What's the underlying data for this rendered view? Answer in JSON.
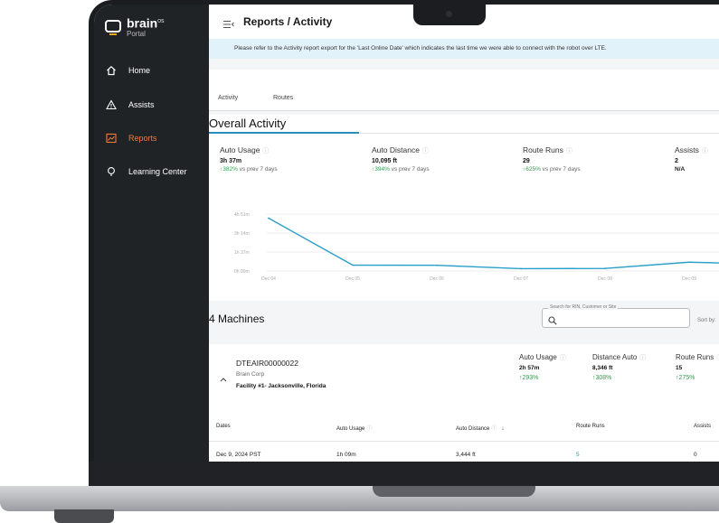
{
  "app": {
    "logo_text": "brain",
    "logo_sup": "OS",
    "logo_sub": "Portal"
  },
  "sidebar": {
    "items": [
      {
        "label": "Home",
        "icon": "home-icon"
      },
      {
        "label": "Assists",
        "icon": "warning-icon"
      },
      {
        "label": "Reports",
        "icon": "chart-icon",
        "active": true
      },
      {
        "label": "Learning Center",
        "icon": "lightbulb-icon"
      }
    ]
  },
  "header": {
    "title": "Reports / Activity"
  },
  "banner": {
    "text": "Please refer to the Activity report export for the 'Last Online Date' which indicates the last time we were able to connect with the robot over LTE."
  },
  "tabs": [
    {
      "label": "Activity",
      "active": true
    },
    {
      "label": "Routes",
      "active": false
    }
  ],
  "overall": {
    "title": "Overall Activity",
    "metrics": [
      {
        "label": "Auto Usage",
        "value": "3h 37m",
        "delta": "382%",
        "delta_suffix": " vs prev 7 days"
      },
      {
        "label": "Auto Distance",
        "value": "10,095 ft",
        "delta": "394%",
        "delta_suffix": " vs prev 7 days"
      },
      {
        "label": "Route Runs",
        "value": "29",
        "delta": "625%",
        "delta_suffix": " vs prev 7 days"
      },
      {
        "label": "Assists",
        "value": "2",
        "delta": "N/A",
        "delta_suffix": ""
      }
    ]
  },
  "chart_data": {
    "type": "line",
    "title": "",
    "xlabel": "",
    "ylabel": "",
    "y_ticks": [
      "4h 51m",
      "3h 14m",
      "1h 37m",
      "0h 00m"
    ],
    "y_tick_minutes": [
      291,
      194,
      97,
      0
    ],
    "ylim": [
      0,
      291
    ],
    "categories": [
      "Dec 04",
      "Dec 05",
      "Dec 06",
      "Dec 07",
      "Dec 08",
      "Dec 09"
    ],
    "series": [
      {
        "values": [
          270,
          30,
          29,
          12,
          13,
          45
        ],
        "color": "#2a9fc9",
        "unit": "minutes"
      }
    ],
    "grid": true,
    "legend": "none"
  },
  "machines": {
    "title": "4 Machines",
    "search_label": "Search for RIN, Customer or Site",
    "sort_label": "Sort by:",
    "card": {
      "id": "DTEAIR00000022",
      "customer": "Brain Corp",
      "site": "Facility #1- Jacksonville, Florida",
      "stats": [
        {
          "label": "Auto Usage",
          "value": "2h 57m",
          "delta": "293%"
        },
        {
          "label": "Distance Auto",
          "value": "8,346 ft",
          "delta": "308%"
        },
        {
          "label": "Route Runs",
          "value": "15",
          "delta": "275%"
        }
      ]
    },
    "table": {
      "headers": [
        "Dates",
        "Auto Usage",
        "Auto Distance",
        "Route Runs",
        "Assists"
      ],
      "rows": [
        [
          "Dec 9, 2024 PST",
          "1h 09m",
          "3,444 ft",
          "5",
          "0"
        ]
      ]
    }
  },
  "colors": {
    "accent": "#2a8fb8",
    "active_nav": "#f27a3b",
    "sidebar_bg": "#1f2326",
    "positive": "#2f9e4f",
    "banner_bg": "#e2f2fa"
  }
}
